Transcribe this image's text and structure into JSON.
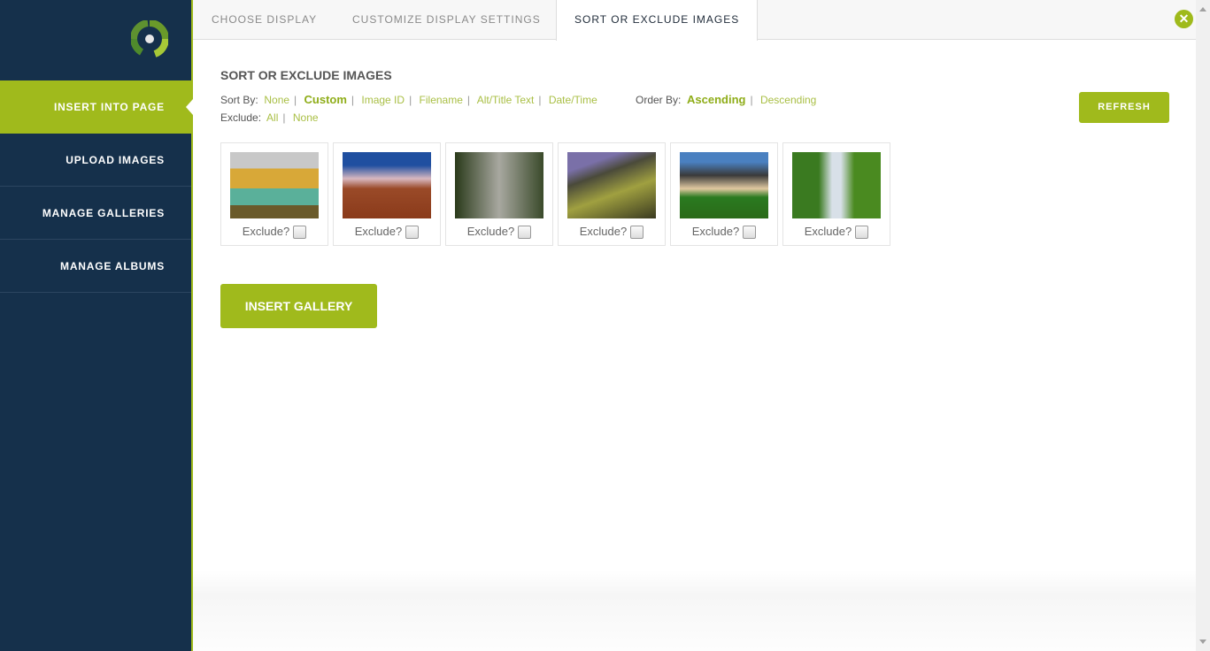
{
  "sidebar": {
    "items": [
      {
        "label": "INSERT INTO PAGE",
        "active": true
      },
      {
        "label": "UPLOAD IMAGES",
        "active": false
      },
      {
        "label": "MANAGE GALLERIES",
        "active": false
      },
      {
        "label": "MANAGE ALBUMS",
        "active": false
      }
    ]
  },
  "tabs": [
    {
      "label": "CHOOSE DISPLAY"
    },
    {
      "label": "CUSTOMIZE DISPLAY SETTINGS"
    },
    {
      "label": "SORT OR EXCLUDE IMAGES",
      "active": true
    }
  ],
  "content": {
    "title": "SORT OR EXCLUDE IMAGES",
    "sort_by_label": "Sort By:",
    "sort_options": [
      "None",
      "Custom",
      "Image ID",
      "Filename",
      "Alt/Title Text",
      "Date/Time"
    ],
    "sort_selected": "Custom",
    "order_by_label": "Order By:",
    "order_options": [
      "Ascending",
      "Descending"
    ],
    "order_selected": "Ascending",
    "exclude_label": "Exclude:",
    "exclude_options": [
      "All",
      "None"
    ],
    "refresh_label": "REFRESH",
    "exclude_prompt": "Exclude?",
    "images": [
      {
        "subject": "coastal cliffs",
        "excluded": false
      },
      {
        "subject": "desert road",
        "excluded": false
      },
      {
        "subject": "forest path",
        "excluded": false
      },
      {
        "subject": "mountain hillside",
        "excluded": false
      },
      {
        "subject": "lone tree field",
        "excluded": false
      },
      {
        "subject": "waterfall",
        "excluded": false
      }
    ],
    "insert_label": "INSERT GALLERY"
  },
  "colors": {
    "accent": "#a0ba1c",
    "sidebar_bg": "#15304b"
  }
}
